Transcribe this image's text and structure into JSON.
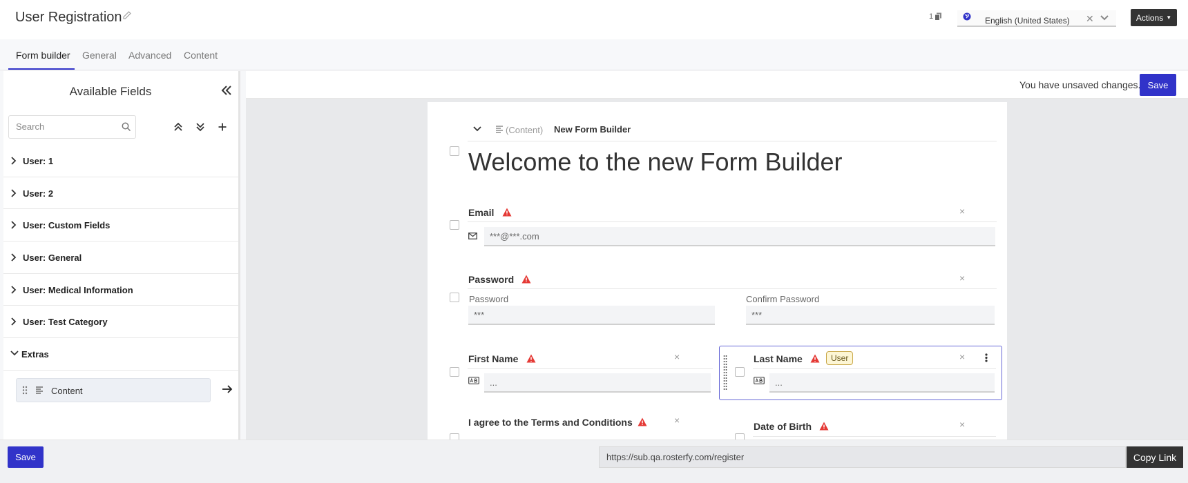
{
  "header": {
    "title": "User Registration",
    "copies_count": "1",
    "language": "English (United States)",
    "actions_label": "Actions"
  },
  "tabs": [
    {
      "label": "Form builder",
      "active": true
    },
    {
      "label": "General"
    },
    {
      "label": "Advanced"
    },
    {
      "label": "Content"
    }
  ],
  "sidebar": {
    "title": "Available Fields",
    "search_placeholder": "Search",
    "groups": [
      {
        "label": "User: 1",
        "expanded": false
      },
      {
        "label": "User: 2",
        "expanded": false
      },
      {
        "label": "User: Custom Fields",
        "expanded": false
      },
      {
        "label": "User: General",
        "expanded": false
      },
      {
        "label": "User: Medical Information",
        "expanded": false
      },
      {
        "label": "User: Test Category",
        "expanded": false
      },
      {
        "label": "Extras",
        "expanded": true
      }
    ],
    "extras_items": [
      {
        "label": "Content"
      }
    ]
  },
  "canvas": {
    "unsaved_message": "You have unsaved changes.",
    "save_label": "Save",
    "content_block": {
      "type_label": "(Content)",
      "name": "New Form Builder",
      "heading": "Welcome to the new Form Builder"
    },
    "fields": {
      "email": {
        "label": "Email",
        "placeholder": "***@***.com"
      },
      "password": {
        "label": "Password",
        "password_sub": "Password",
        "confirm_sub": "Confirm Password",
        "value": "***",
        "confirm_value": "***"
      },
      "first_name": {
        "label": "First Name",
        "placeholder": "..."
      },
      "last_name": {
        "label": "Last Name",
        "badge": "User",
        "placeholder": "..."
      },
      "terms": {
        "label": "I agree to the Terms and Conditions"
      },
      "dob": {
        "label": "Date of Birth"
      }
    }
  },
  "footer": {
    "save_label": "Save",
    "link": "https://sub.qa.rosterfy.com/register",
    "copy_label": "Copy Link"
  },
  "colors": {
    "primary": "#3133c9",
    "warning": "#e53935",
    "dark_button": "#333333"
  }
}
